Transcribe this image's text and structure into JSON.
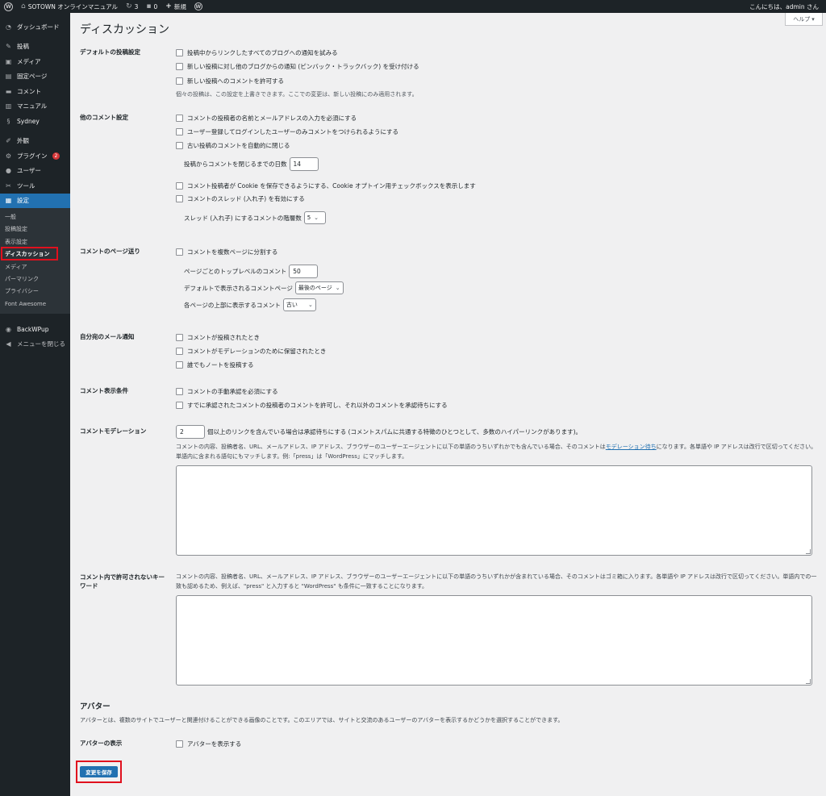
{
  "adminbar": {
    "site_name": "SOTOWN オンラインマニュアル",
    "updates_count": "3",
    "comments_count": "0",
    "new_label": "新規",
    "greeting": "こんにちは、admin さん"
  },
  "sidebar": {
    "items": [
      {
        "label": "ダッシュボード",
        "icon": "dashboard-icon"
      },
      {
        "label": "投稿",
        "icon": "pin-icon"
      },
      {
        "label": "メディア",
        "icon": "media-icon"
      },
      {
        "label": "固定ページ",
        "icon": "page-icon"
      },
      {
        "label": "コメント",
        "icon": "comment-icon"
      },
      {
        "label": "マニュアル",
        "icon": "manual-icon"
      },
      {
        "label": "Sydney",
        "icon": "sydney-icon"
      },
      {
        "label": "外観",
        "icon": "brush-icon"
      },
      {
        "label": "プラグイン",
        "icon": "plugin-icon",
        "badge": "2"
      },
      {
        "label": "ユーザー",
        "icon": "user-icon"
      },
      {
        "label": "ツール",
        "icon": "wrench-icon"
      },
      {
        "label": "設定",
        "icon": "settings-icon"
      }
    ],
    "submenu": [
      "一般",
      "投稿設定",
      "表示設定",
      "ディスカッション",
      "メディア",
      "パーマリンク",
      "プライバシー",
      "Font Awesome"
    ],
    "backwpup": "BackWPup",
    "collapse": "メニューを閉じる"
  },
  "main": {
    "help_label": "ヘルプ",
    "title": "ディスカッション",
    "default_settings": {
      "label": "デフォルトの投稿設定",
      "options": [
        "投稿中からリンクしたすべてのブログへの通知を試みる",
        "新しい投稿に対し他のブログからの通知 (ピンバック・トラックバック) を受け付ける",
        "新しい投稿へのコメントを許可する"
      ],
      "note": "個々の投稿は、この設定を上書きできます。ここでの変更は、新しい投稿にのみ適用されます。"
    },
    "other_settings": {
      "label": "他のコメント設定",
      "options": [
        "コメントの投稿者の名前とメールアドレスの入力を必須にする",
        "ユーザー登録してログインしたユーザーのみコメントをつけられるようにする",
        "古い投稿のコメントを自動的に閉じる"
      ],
      "close_days_label": "投稿からコメントを閉じるまでの日数",
      "close_days_value": "14",
      "options2": [
        "コメント投稿者が Cookie を保存できるようにする、Cookie オプトイン用チェックボックスを表示します",
        "コメントのスレッド (入れ子) を有効にする"
      ],
      "thread_depth_label": "スレッド (入れ子) にするコメントの階層数",
      "thread_depth_value": "5"
    },
    "pagination": {
      "label": "コメントのページ送り",
      "option": "コメントを複数ページに分割する",
      "per_page_label": "ページごとのトップレベルのコメント",
      "per_page_value": "50",
      "default_page_label": "デフォルトで表示されるコメントページ",
      "default_page_value": "最後のページ",
      "top_order_label": "各ページの上部に表示するコメント",
      "top_order_value": "古い"
    },
    "email": {
      "label": "自分宛のメール通知",
      "options": [
        "コメントが投稿されたとき",
        "コメントがモデレーションのために保留されたとき",
        "誰でもノートを投稿する"
      ]
    },
    "display_conditions": {
      "label": "コメント表示条件",
      "options": [
        "コメントの手動承認を必須にする",
        "すでに承認されたコメントの投稿者のコメントを許可し、それ以外のコメントを承認待ちにする"
      ]
    },
    "moderation": {
      "label": "コメントモデレーション",
      "links_value": "2",
      "links_text": "個以上のリンクを含んでいる場合は承認待ちにする (コメントスパムに共通する特徴のひとつとして、多数のハイパーリンクがあります)。",
      "desc_before": "コメントの内容、投稿者名、URL、メールアドレス、IP アドレス、ブラウザーのユーザーエージェントに以下の単語のうちいずれかでも含んでいる場合、そのコメントは",
      "desc_link": "モデレーション待ち",
      "desc_after": "になります。各単語や IP アドレスは改行で区切ってください。単語内に含まれる語句にもマッチします。例:「press」は「WordPress」にマッチします。"
    },
    "disallowed": {
      "label": "コメント内で許可されないキーワード",
      "desc": "コメントの内容、投稿者名、URL、メールアドレス、IP アドレス、ブラウザーのユーザーエージェントに以下の単語のうちいずれかが含まれている場合、そのコメントはゴミ箱に入ります。各単語や IP アドレスは改行で区切ってください。単語内での一致も認めるため、例えば、\"press\" と入力すると \"WordPress\" も条件に一致することになります。"
    },
    "avatar": {
      "heading": "アバター",
      "desc": "アバターとは、複数のサイトでユーザーと関連付けることができる画像のことです。このエリアでは、サイトと交流のあるユーザーのアバターを表示するかどうかを選択することができます。",
      "label": "アバターの表示",
      "option": "アバターを表示する"
    },
    "save_label": "変更を保存"
  },
  "colors": {
    "admin_bar": "#1d2327",
    "accent": "#2271b1",
    "highlight_box": "#e0101e",
    "background": "#f0f0f1"
  }
}
